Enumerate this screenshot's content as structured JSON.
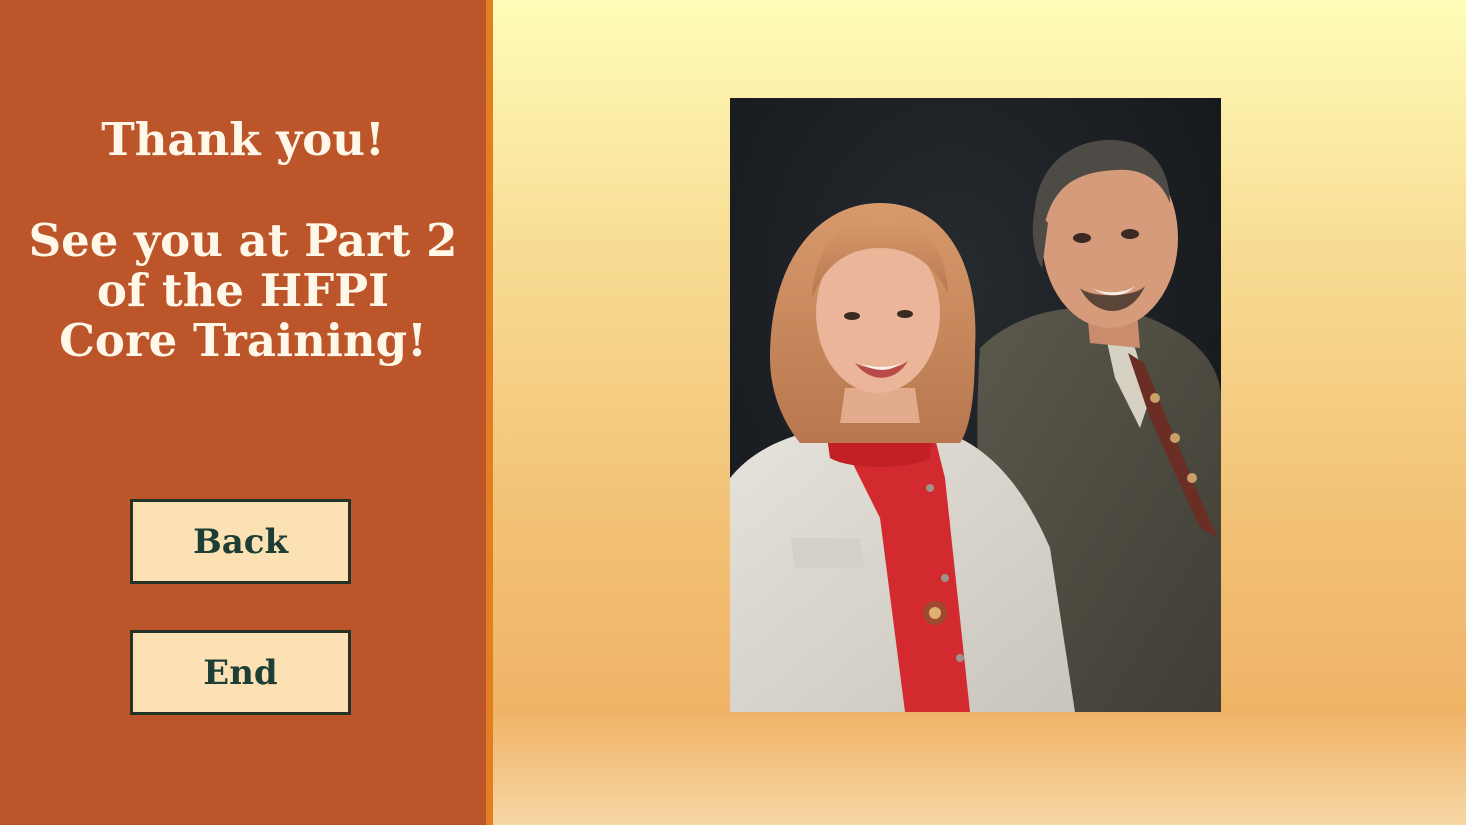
{
  "slide": {
    "thanks": "Thank you!",
    "see_you_lines": [
      "See you at Part 2",
      "of the HFPI",
      "Core Training!"
    ]
  },
  "navigation": {
    "back_label": "Back",
    "end_label": "End"
  },
  "colors": {
    "panel": "#bd552b",
    "divider": "#e37f22",
    "button_fill": "#fbe1b4",
    "button_text": "#1d3e35",
    "heading_text": "#fff8e8"
  }
}
